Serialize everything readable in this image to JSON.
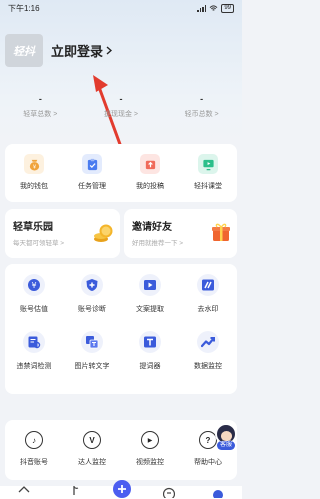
{
  "status_bar": {
    "time": "下午1:16",
    "battery": "99"
  },
  "profile": {
    "logo_text": "轻抖",
    "login_label": "立即登录"
  },
  "stats": [
    {
      "value": "-",
      "label": "轻草总数 >"
    },
    {
      "value": "-",
      "label": "提现现金 >"
    },
    {
      "value": "-",
      "label": "轻币总数 >"
    }
  ],
  "quick_menu": [
    {
      "label": "我的钱包",
      "icon": "wallet-icon",
      "color": "#f0a33a",
      "bg": "#fdf1df"
    },
    {
      "label": "任务管理",
      "icon": "task-icon",
      "color": "#4a7cf0",
      "bg": "#e3ebfd"
    },
    {
      "label": "我的投稿",
      "icon": "upload-icon",
      "color": "#f06a5a",
      "bg": "#fde5e2"
    },
    {
      "label": "轻抖课堂",
      "icon": "classroom-icon",
      "color": "#2bbf8a",
      "bg": "#dcf5ec"
    }
  ],
  "promo": {
    "left": {
      "title": "轻草乐园",
      "subtitle": "每天都可领轻草 >"
    },
    "right": {
      "title": "邀请好友",
      "subtitle": "好用就推荐一下 >"
    }
  },
  "tools": [
    {
      "label": "账号估值",
      "icon": "valuation-icon"
    },
    {
      "label": "账号诊断",
      "icon": "diagnosis-icon"
    },
    {
      "label": "文案提取",
      "icon": "video-extract-icon"
    },
    {
      "label": "去水印",
      "icon": "watermark-icon"
    },
    {
      "label": "违禁词检测",
      "icon": "forbidden-word-icon"
    },
    {
      "label": "图片转文字",
      "icon": "image-to-text-icon"
    },
    {
      "label": "提词器",
      "icon": "teleprompter-icon"
    },
    {
      "label": "数据监控",
      "icon": "trend-icon"
    }
  ],
  "monitor": [
    {
      "label": "抖音账号",
      "icon": "tiktok-icon",
      "glyph": "♪"
    },
    {
      "label": "达人监控",
      "icon": "influencer-icon",
      "glyph": "V"
    },
    {
      "label": "视频监控",
      "icon": "play-icon",
      "glyph": "▶"
    },
    {
      "label": "帮助中心",
      "icon": "help-icon",
      "glyph": "?"
    }
  ],
  "kefu_label": "客服",
  "accent": "#3b5bdb",
  "annotation_color": "#e23b2e"
}
